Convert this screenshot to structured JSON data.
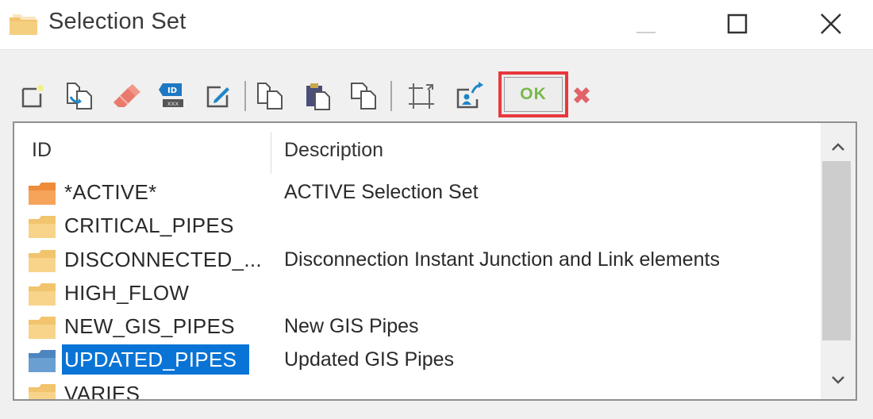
{
  "window": {
    "title": "Selection Set",
    "controls": {
      "minimize": "minimize",
      "maximize": "maximize",
      "close": "close"
    }
  },
  "toolbar": {
    "buttons": [
      {
        "name": "new",
        "icon": "new-document-icon",
        "tooltip": "New"
      },
      {
        "name": "duplicate",
        "icon": "duplicate-icon",
        "tooltip": "Duplicate"
      },
      {
        "name": "delete",
        "icon": "eraser-icon",
        "tooltip": "Delete"
      },
      {
        "name": "rename",
        "icon": "id-tag-icon",
        "tooltip": "Rename"
      },
      {
        "name": "edit",
        "icon": "edit-icon",
        "tooltip": "Edit"
      },
      {
        "name": "copy",
        "icon": "copy-icon",
        "tooltip": "Copy"
      },
      {
        "name": "paste",
        "icon": "paste-icon",
        "tooltip": "Paste"
      },
      {
        "name": "copy-alt",
        "icon": "copy-pages-icon",
        "tooltip": "Copy"
      },
      {
        "name": "select",
        "icon": "select-elements-icon",
        "tooltip": "Select"
      },
      {
        "name": "export",
        "icon": "export-icon",
        "tooltip": "Export"
      }
    ],
    "ok_label": "OK",
    "cancel_label": "✖"
  },
  "list": {
    "columns": {
      "id": "ID",
      "description": "Description"
    },
    "rows": [
      {
        "id": "*ACTIVE*",
        "description": "ACTIVE Selection Set",
        "folder_color": "orange",
        "selected": false
      },
      {
        "id": "CRITICAL_PIPES",
        "description": "",
        "folder_color": "yellow",
        "selected": false
      },
      {
        "id": "DISCONNECTED_...",
        "description": "Disconnection Instant Junction and Link elements",
        "folder_color": "yellow",
        "selected": false
      },
      {
        "id": "HIGH_FLOW",
        "description": "",
        "folder_color": "yellow",
        "selected": false
      },
      {
        "id": "NEW_GIS_PIPES",
        "description": "New GIS Pipes",
        "folder_color": "yellow",
        "selected": false
      },
      {
        "id": "UPDATED_PIPES",
        "description": "Updated GIS Pipes",
        "folder_color": "blue",
        "selected": true
      },
      {
        "id": "VARIES",
        "description": "",
        "folder_color": "yellow",
        "selected": false
      }
    ]
  },
  "colors": {
    "selection": "#0a74d6",
    "highlight_box": "#e8383d",
    "ok_text": "#78b84a",
    "cancel": "#e0636a",
    "folder_yellow": "#f2c46d",
    "folder_orange": "#ef8c3a",
    "folder_blue": "#5b93c9"
  }
}
